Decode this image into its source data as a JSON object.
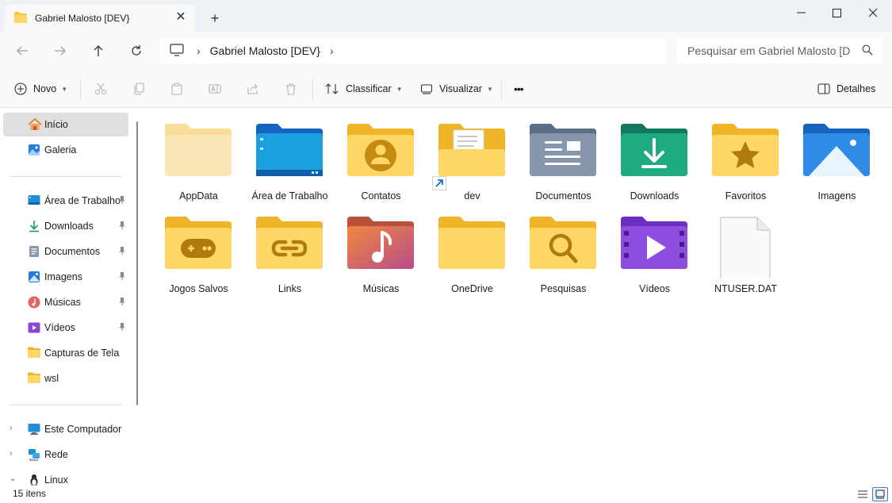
{
  "window": {
    "tab_title": "Gabriel Malosto [DEV}",
    "tab_close": "✕",
    "new_tab": "+",
    "minimize": "—",
    "maximize": "☐",
    "close": "✕"
  },
  "address": {
    "breadcrumb": [
      "Gabriel Malosto [DEV}"
    ],
    "search_placeholder": "Pesquisar em Gabriel Malosto [D"
  },
  "commands": {
    "new_label": "Novo",
    "sort_label": "Classificar",
    "view_label": "Visualizar",
    "more_label": "•••",
    "details_label": "Detalhes"
  },
  "sidebar": {
    "top": [
      {
        "label": "Início",
        "icon": "home-icon",
        "selected": true
      },
      {
        "label": "Galeria",
        "icon": "gallery-icon"
      }
    ],
    "pinned": [
      {
        "label": "Área de Trabalho",
        "icon": "desktop-icon",
        "pinned": true
      },
      {
        "label": "Downloads",
        "icon": "download-icon",
        "pinned": true
      },
      {
        "label": "Documentos",
        "icon": "documents-icon",
        "pinned": true
      },
      {
        "label": "Imagens",
        "icon": "pictures-icon",
        "pinned": true
      },
      {
        "label": "Músicas",
        "icon": "music-icon",
        "pinned": true
      },
      {
        "label": "Vídeos",
        "icon": "videos-icon",
        "pinned": true
      },
      {
        "label": "Capturas de Tela",
        "icon": "folder-icon"
      },
      {
        "label": "wsl",
        "icon": "folder-icon"
      }
    ],
    "devices": [
      {
        "label": "Este Computador",
        "icon": "computer-icon",
        "expander": "›"
      },
      {
        "label": "Rede",
        "icon": "network-icon",
        "expander": "›"
      },
      {
        "label": "Linux",
        "icon": "linux-icon",
        "expander": "⌄"
      }
    ]
  },
  "items": [
    {
      "label": "AppData",
      "icon": "appdata-folder-icon"
    },
    {
      "label": "Área de Trabalho",
      "icon": "desktop-folder-icon"
    },
    {
      "label": "Contatos",
      "icon": "contacts-folder-icon"
    },
    {
      "label": "dev",
      "icon": "shortcut-folder-icon"
    },
    {
      "label": "Documentos",
      "icon": "documents-folder-icon"
    },
    {
      "label": "Downloads",
      "icon": "downloads-folder-icon"
    },
    {
      "label": "Favoritos",
      "icon": "favorites-folder-icon"
    },
    {
      "label": "Imagens",
      "icon": "pictures-folder-icon"
    },
    {
      "label": "Jogos Salvos",
      "icon": "saved-games-folder-icon"
    },
    {
      "label": "Links",
      "icon": "links-folder-icon"
    },
    {
      "label": "Músicas",
      "icon": "music-folder-icon"
    },
    {
      "label": "OneDrive",
      "icon": "onedrive-folder-icon"
    },
    {
      "label": "Pesquisas",
      "icon": "searches-folder-icon"
    },
    {
      "label": "Vídeos",
      "icon": "videos-folder-icon"
    },
    {
      "label": "NTUSER.DAT",
      "icon": "file-icon"
    }
  ],
  "status": {
    "count": "15 itens"
  },
  "colors": {
    "folder_yellow": "#f8c640",
    "folder_light": "#ffe08a",
    "accent": "#0067c0",
    "selected_bg": "#e0e0e0"
  }
}
